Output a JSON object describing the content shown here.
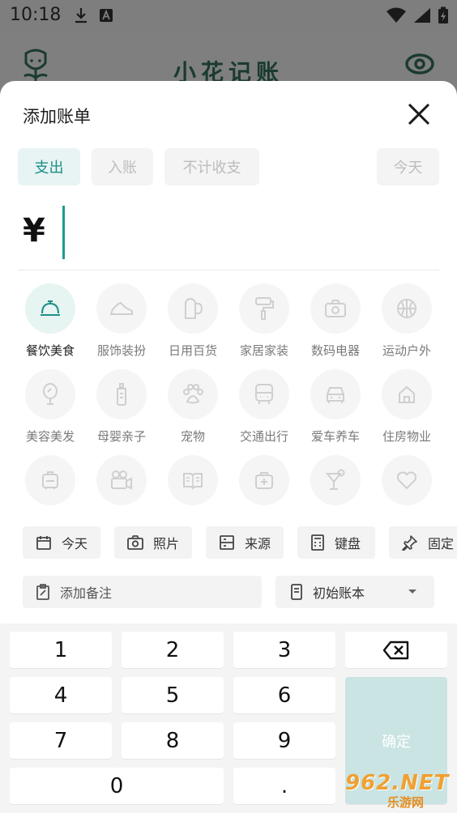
{
  "status": {
    "time": "10:18"
  },
  "app": {
    "title": "小花记账"
  },
  "sheet": {
    "title": "添加账单"
  },
  "type_tabs": [
    {
      "label": "支出",
      "active": true
    },
    {
      "label": "入账",
      "active": false
    },
    {
      "label": "不计收支",
      "active": false
    }
  ],
  "date_chip": "今天",
  "amount": {
    "currency": "¥",
    "value": ""
  },
  "categories": [
    {
      "label": "餐饮美食",
      "icon": "dining-bell-icon",
      "selected": true
    },
    {
      "label": "服饰装扮",
      "icon": "shoe-icon"
    },
    {
      "label": "日用百货",
      "icon": "toilet-paper-icon"
    },
    {
      "label": "家居家装",
      "icon": "paint-roller-icon"
    },
    {
      "label": "数码电器",
      "icon": "camera-icon"
    },
    {
      "label": "运动户外",
      "icon": "basketball-icon"
    },
    {
      "label": "美容美发",
      "icon": "mirror-icon"
    },
    {
      "label": "母婴亲子",
      "icon": "baby-bottle-icon"
    },
    {
      "label": "宠物",
      "icon": "paw-icon"
    },
    {
      "label": "交通出行",
      "icon": "bus-icon"
    },
    {
      "label": "爱车养车",
      "icon": "car-icon"
    },
    {
      "label": "住房物业",
      "icon": "house-icon"
    },
    {
      "label": "",
      "icon": "suitcase-icon"
    },
    {
      "label": "",
      "icon": "video-camera-icon"
    },
    {
      "label": "",
      "icon": "book-icon"
    },
    {
      "label": "",
      "icon": "medical-kit-icon"
    },
    {
      "label": "",
      "icon": "cocktail-icon"
    },
    {
      "label": "",
      "icon": "heart-icon"
    }
  ],
  "tools": [
    {
      "label": "今天",
      "icon": "calendar-icon"
    },
    {
      "label": "照片",
      "icon": "camera-icon"
    },
    {
      "label": "来源",
      "icon": "source-card-icon"
    },
    {
      "label": "键盘",
      "icon": "calculator-icon"
    },
    {
      "label": "固定",
      "icon": "pin-icon"
    }
  ],
  "note": {
    "label": "添加备注"
  },
  "account_book": {
    "label": "初始账本"
  },
  "keypad": {
    "keys": [
      "1",
      "2",
      "3",
      "4",
      "5",
      "6",
      "7",
      "8",
      "9",
      "0",
      "."
    ],
    "confirm": "确定"
  },
  "watermark": {
    "main": "962.NET",
    "sub": "乐游网"
  },
  "colors": {
    "accent": "#1d8f86",
    "confirm_bg": "#c9e4e2",
    "selected_bg": "#e6f4f2"
  }
}
